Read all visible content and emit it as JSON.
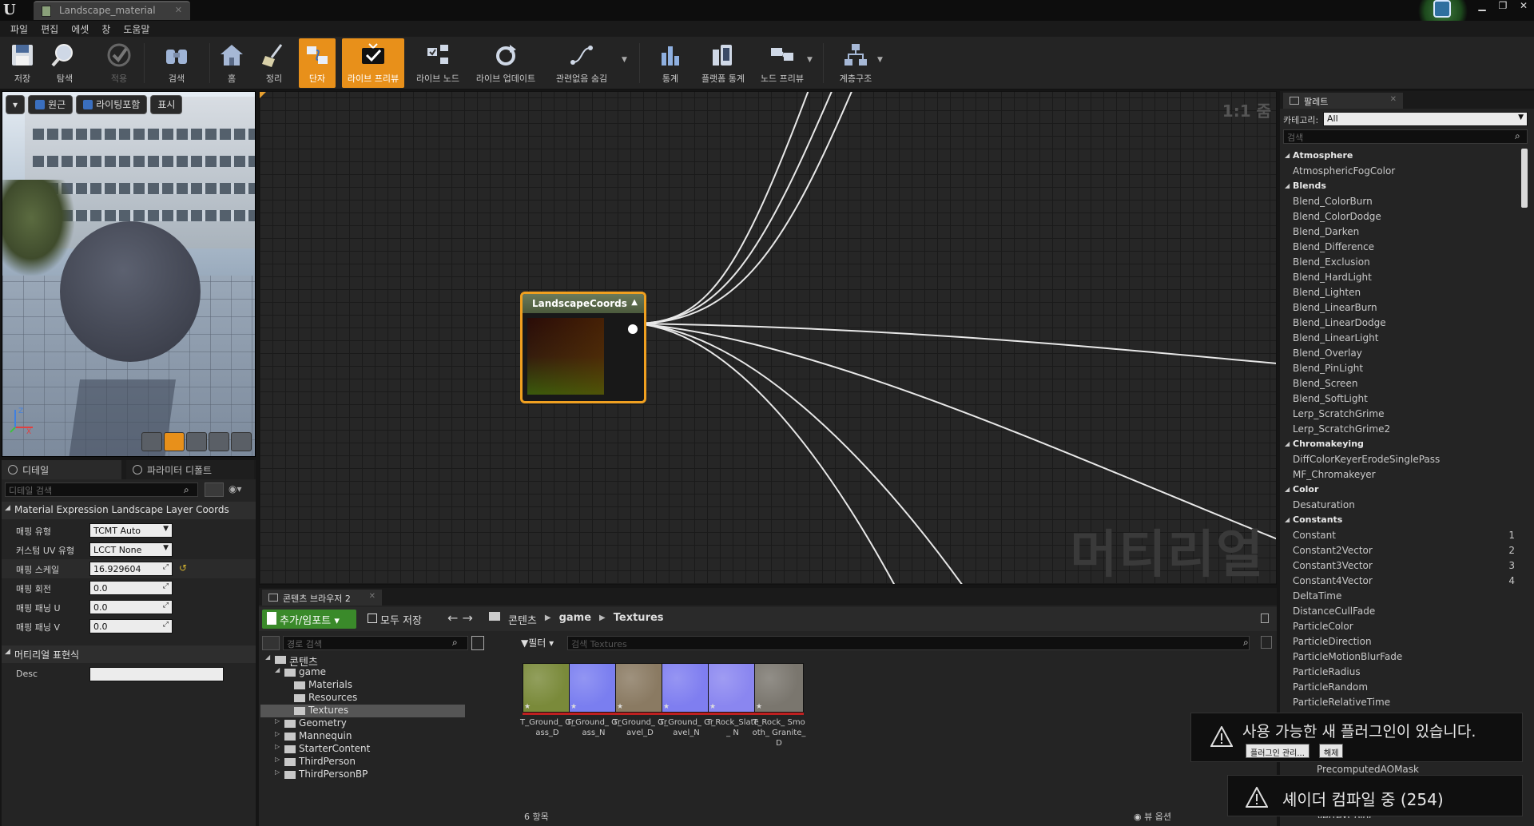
{
  "window": {
    "tab_title": "Landscape_material",
    "controls": [
      "▁",
      "❐",
      "✕"
    ]
  },
  "menu": [
    "파일",
    "편집",
    "에셋",
    "창",
    "도움말"
  ],
  "toolbar": {
    "save": "저장",
    "browse": "탐색",
    "apply": "적용",
    "search": "검색",
    "home": "홈",
    "clean_up": "정리",
    "connectors": "단자",
    "live_preview": "라이브 프리뷰",
    "live_nodes": "라이브 노드",
    "live_update": "라이브 업데이트",
    "hide_unrelated": "관련없음 숨김",
    "stats": "통계",
    "platform_stats": "플랫폼 통계",
    "node_preview": "노드 프리뷰",
    "hierarchy": "계층구조"
  },
  "viewport": {
    "perspective": "원근",
    "lighting": "라이팅포함",
    "show": "표시",
    "axis_z": "Z",
    "axis_x": "X"
  },
  "details": {
    "tab_details": "디테일",
    "tab_params": "파라미터 디폴트",
    "search_placeholder": "디테일 검색",
    "category1": "Material Expression Landscape Layer Coords",
    "props": [
      {
        "label": "매핑 유형",
        "value": "TCMT Auto"
      },
      {
        "label": "커스텀 UV 유형",
        "value": "LCCT None"
      },
      {
        "label": "매핑 스케일",
        "value": "16.929604"
      },
      {
        "label": "매핑 회전",
        "value": "0.0"
      },
      {
        "label": "매핑 패닝 U",
        "value": "0.0"
      },
      {
        "label": "매핑 패닝 V",
        "value": "0.0"
      }
    ],
    "category2": "머티리얼 표현식",
    "desc_label": "Desc",
    "desc_value": ""
  },
  "graph": {
    "zoom": "1:1 줌",
    "watermark": "머티리얼",
    "node_title": "LandscapeCoords"
  },
  "content_browser": {
    "tab": "콘텐츠 브라우저 2",
    "add_import": "추가/임포트",
    "save_all": "모두 저장",
    "path": [
      "콘텐츠",
      "game",
      "Textures"
    ],
    "path_search_placeholder": "경로 검색",
    "filter": "필터",
    "asset_search_placeholder": "검색 Textures",
    "tree": [
      {
        "label": "콘텐츠",
        "level": 0,
        "open": true
      },
      {
        "label": "game",
        "level": 1,
        "open": true
      },
      {
        "label": "Materials",
        "level": 2,
        "open": false
      },
      {
        "label": "Resources",
        "level": 2,
        "open": false
      },
      {
        "label": "Textures",
        "level": 2,
        "open": false,
        "selected": true
      },
      {
        "label": "Geometry",
        "level": 1,
        "open": false
      },
      {
        "label": "Mannequin",
        "level": 1,
        "open": false
      },
      {
        "label": "StarterContent",
        "level": 1,
        "open": false
      },
      {
        "label": "ThirdPerson",
        "level": 1,
        "open": false
      },
      {
        "label": "ThirdPersonBP",
        "level": 1,
        "open": false
      }
    ],
    "assets": [
      {
        "name": "T_Ground_ Grass_D",
        "color": "#7a8a3a"
      },
      {
        "name": "T_Ground_ Grass_N",
        "color": "#7a7ef0"
      },
      {
        "name": "T_Ground_ Gravel_D",
        "color": "#8a7a62"
      },
      {
        "name": "T_Ground_ Gravel_N",
        "color": "#7f7ef0"
      },
      {
        "name": "T_Rock_Slate_ N",
        "color": "#8a86f0"
      },
      {
        "name": "T_Rock_ Smooth_ Granite_D",
        "color": "#7a766e"
      }
    ],
    "item_count": "6 항목",
    "view_options": "뷰 옵션"
  },
  "palette": {
    "tab": "팔레트",
    "category_label": "카테고리:",
    "category_value": "All",
    "search_placeholder": "검색",
    "items": [
      {
        "label": "Atmosphere",
        "cat": true
      },
      {
        "label": "AtmosphericFogColor"
      },
      {
        "label": "Blends",
        "cat": true
      },
      {
        "label": "Blend_ColorBurn"
      },
      {
        "label": "Blend_ColorDodge"
      },
      {
        "label": "Blend_Darken"
      },
      {
        "label": "Blend_Difference"
      },
      {
        "label": "Blend_Exclusion"
      },
      {
        "label": "Blend_HardLight"
      },
      {
        "label": "Blend_Lighten"
      },
      {
        "label": "Blend_LinearBurn"
      },
      {
        "label": "Blend_LinearDodge"
      },
      {
        "label": "Blend_LinearLight"
      },
      {
        "label": "Blend_Overlay"
      },
      {
        "label": "Blend_PinLight"
      },
      {
        "label": "Blend_Screen"
      },
      {
        "label": "Blend_SoftLight"
      },
      {
        "label": "Lerp_ScratchGrime"
      },
      {
        "label": "Lerp_ScratchGrime2"
      },
      {
        "label": "Chromakeying",
        "cat": true
      },
      {
        "label": "DiffColorKeyerErodeSinglePass"
      },
      {
        "label": "MF_Chromakeyer"
      },
      {
        "label": "Color",
        "cat": true
      },
      {
        "label": "Desaturation"
      },
      {
        "label": "Constants",
        "cat": true
      },
      {
        "label": "Constant",
        "key": "1"
      },
      {
        "label": "Constant2Vector",
        "key": "2"
      },
      {
        "label": "Constant3Vector",
        "key": "3"
      },
      {
        "label": "Constant4Vector",
        "key": "4"
      },
      {
        "label": "DeltaTime"
      },
      {
        "label": "DistanceCullFade"
      },
      {
        "label": "ParticleColor"
      },
      {
        "label": "ParticleDirection"
      },
      {
        "label": "ParticleMotionBlurFade"
      },
      {
        "label": "ParticleRadius"
      },
      {
        "label": "ParticleRandom"
      },
      {
        "label": "ParticleRelativeTime"
      },
      {
        "label": "ParticleSize"
      }
    ],
    "hidden_items": [
      "PrecomputedAOMask",
      "VertexColor"
    ]
  },
  "notifications": {
    "plugin_title": "사용 가능한 새 플러그인이 있습니다.",
    "plugin_manage": "플러그인 관리...",
    "plugin_dismiss": "해제",
    "compile_title": "셰이더 컴파일 중 (254)"
  },
  "colors": {
    "accent_orange": "#e8901a",
    "add_green": "#3a8a2a",
    "node_header": "#5b6a4a"
  }
}
